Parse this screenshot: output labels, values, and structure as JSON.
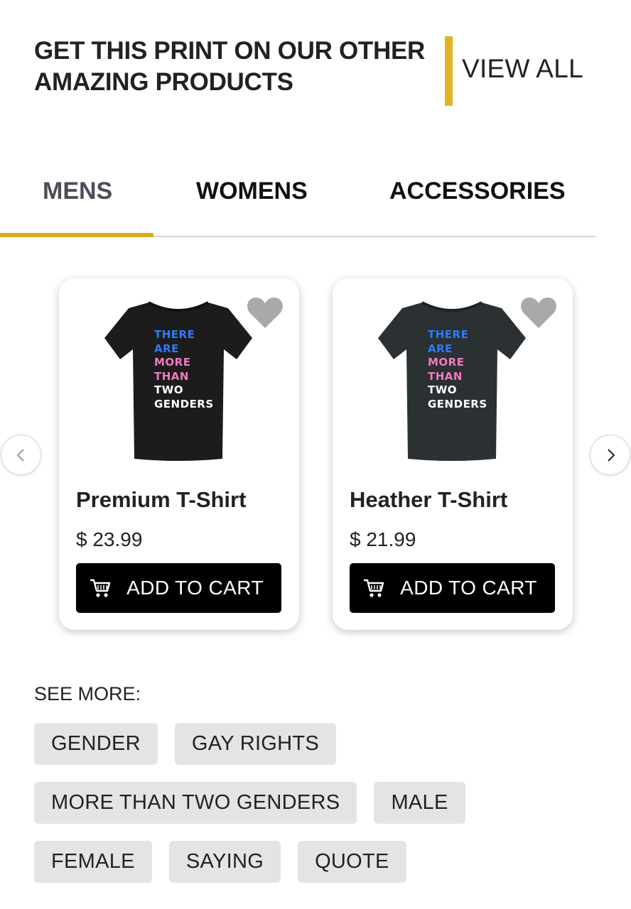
{
  "header": {
    "title_line1": "GET THIS PRINT ON OUR OTHER",
    "title_line2": "AMAZING PRODUCTS",
    "view_all": "VIEW ALL",
    "accent_color": "#e0b523"
  },
  "tabs": [
    {
      "label": "MENS",
      "active": true
    },
    {
      "label": "WOMENS",
      "active": false
    },
    {
      "label": "ACCESSORIES",
      "active": false
    }
  ],
  "products": [
    {
      "name": "Premium T-Shirt",
      "price": "$ 23.99",
      "button": "ADD TO CART",
      "shirt_color": "#1c1c1c",
      "print_lines": [
        "THERE",
        "ARE",
        "MORE",
        "THAN",
        "TWO",
        "GENDERS"
      ],
      "favorite_icon": "heart-icon"
    },
    {
      "name": "Heather T-Shirt",
      "price": "$ 21.99",
      "button": "ADD TO CART",
      "shirt_color": "#2b3033",
      "print_lines": [
        "THERE",
        "ARE",
        "MORE",
        "THAN",
        "TWO",
        "GENDERS"
      ],
      "favorite_icon": "heart-icon"
    }
  ],
  "print_colors": {
    "blue": "#2a7cff",
    "pink": "#f07ac0",
    "white": "#ffffff"
  },
  "see_more": {
    "label": "SEE MORE:",
    "tags": [
      [
        "GENDER",
        "GAY RIGHTS"
      ],
      [
        "MORE THAN TWO GENDERS",
        "MALE"
      ],
      [
        "FEMALE",
        "SAYING",
        "QUOTE"
      ]
    ]
  },
  "icons": {
    "prev": "chevron-left-icon",
    "next": "chevron-right-icon",
    "cart": "cart-icon",
    "favorite": "heart-icon"
  }
}
